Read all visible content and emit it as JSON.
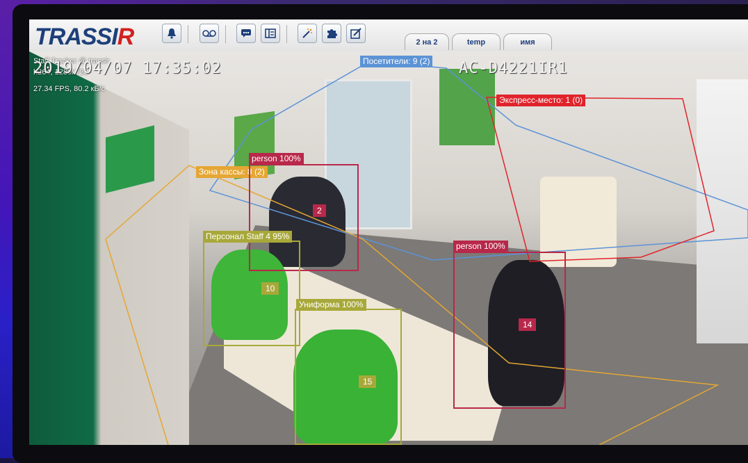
{
  "app": {
    "brand_prefix": "TRASSI",
    "brand_suffix": "R"
  },
  "toolbar": {
    "icons": [
      "bell-icon",
      "voicemail-icon",
      "chat-icon",
      "layout-icon",
      "magic-wand-icon",
      "puzzle-icon",
      "edit-icon"
    ],
    "tabs": [
      {
        "label": "2 на 2"
      },
      {
        "label": "temp"
      },
      {
        "label": "имя"
      }
    ]
  },
  "osd": {
    "camera_line": "Staff Tracker @ trassir",
    "codec_line": "h264, 1280x720",
    "fps_line": "27.34 FPS, 80.2 кБ/с",
    "timestamp": "2019/04/07 17:35:02",
    "camera_model": "AC-D4221IR1"
  },
  "zones": {
    "visitors": "Посетители: 9 (2)",
    "express": "Экспресс-место: 1 (0)",
    "cashier": "Зона кассы: 8 (2)"
  },
  "detections": {
    "person_a_label": "person 100%",
    "person_a_id": "2",
    "person_b_label": "person 100%",
    "person_b_id": "14",
    "staff_label": "Персонал Staff 4 95%",
    "staff_id": "10",
    "uniform_label": "Униформа 100%",
    "uniform_id": "15"
  },
  "colors": {
    "person_box": "#b8284a",
    "staff_box": "#a8a83a",
    "zone_visitors": "#5c93d6",
    "zone_express": "#e0232b",
    "zone_cashier": "#e5a633"
  }
}
